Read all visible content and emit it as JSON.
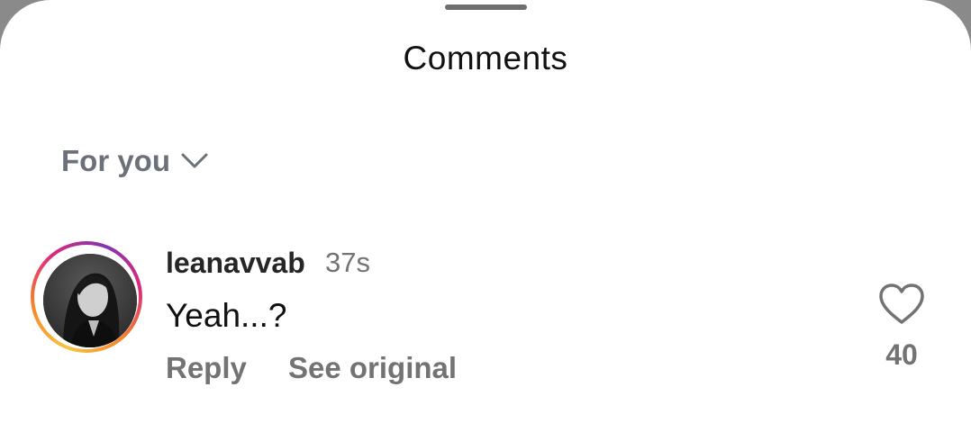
{
  "header": {
    "title": "Comments"
  },
  "filter": {
    "label": "For you",
    "icon": "chevron-down-icon"
  },
  "comments": [
    {
      "username": "leanavvab",
      "time": "37s",
      "text": "Yeah...?",
      "reply_label": "Reply",
      "see_original_label": "See original",
      "like_icon": "heart-outline-icon",
      "like_count": "40"
    }
  ],
  "colors": {
    "story_ring": [
      "#f7c543",
      "#f58529",
      "#dd2a7b",
      "#8134af"
    ],
    "secondary_text": "#737373"
  }
}
